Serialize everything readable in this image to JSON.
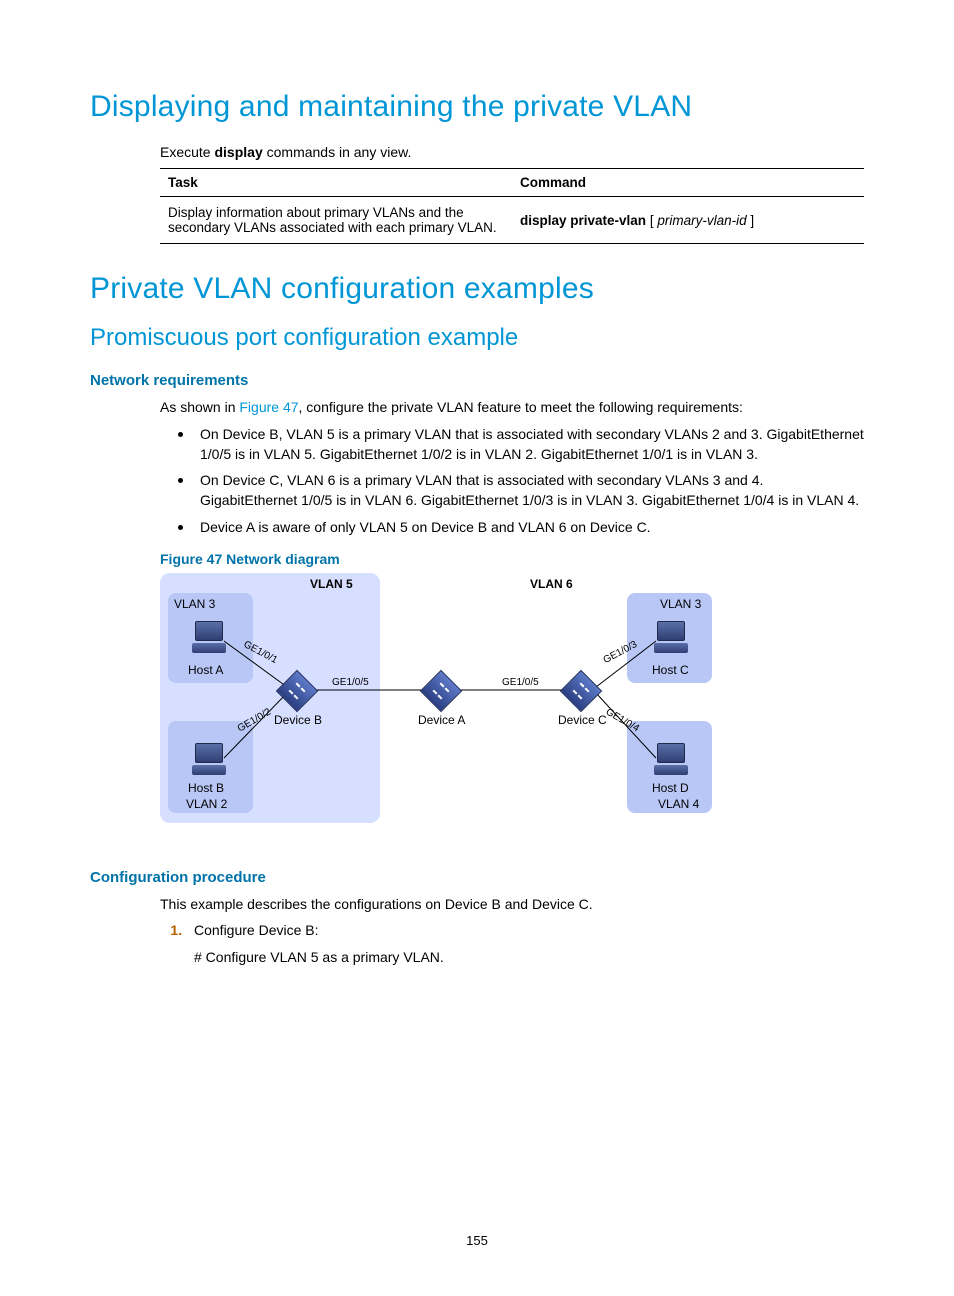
{
  "heading1": "Displaying and maintaining the private VLAN",
  "intro_prefix": "Execute ",
  "intro_bold": "display",
  "intro_suffix": " commands in any view.",
  "table": {
    "th_task": "Task",
    "th_command": "Command",
    "row0_task": "Display information about primary VLANs and the secondary VLANs associated with each primary VLAN.",
    "row0_cmd_bold": "display private-vlan",
    "row0_cmd_rest1": " [ ",
    "row0_cmd_italic": "primary-vlan-id",
    "row0_cmd_rest2": " ]"
  },
  "heading2": "Private VLAN configuration examples",
  "heading3": "Promiscuous port configuration example",
  "netreq_h": "Network requirements",
  "netreq_p_prefix": "As shown in ",
  "netreq_p_link": "Figure 47",
  "netreq_p_suffix": ", configure the private VLAN feature to meet the following requirements:",
  "bullets": [
    "On Device B, VLAN 5 is a primary VLAN that is associated with secondary VLANs 2 and 3. GigabitEthernet 1/0/5 is in VLAN 5. GigabitEthernet 1/0/2 is in VLAN 2. GigabitEthernet 1/0/1 is in VLAN 3.",
    "On Device C, VLAN 6 is a primary VLAN that is associated with secondary VLANs 3 and 4. GigabitEthernet 1/0/5 is in VLAN 6. GigabitEthernet 1/0/3 is in VLAN 3. GigabitEthernet 1/0/4 is in VLAN 4.",
    "Device A is aware of only VLAN 5 on Device B and VLAN 6 on Device C."
  ],
  "figcap": "Figure 47 Network diagram",
  "diagram": {
    "vlan5": "VLAN 5",
    "vlan6": "VLAN 6",
    "vlan3a": "VLAN 3",
    "vlan2": "VLAN 2",
    "vlan3b": "VLAN 3",
    "vlan4": "VLAN 4",
    "hostA": "Host A",
    "hostB": "Host B",
    "hostC": "Host C",
    "hostD": "Host D",
    "devA": "Device A",
    "devB": "Device B",
    "devC": "Device C",
    "ge101": "GE1/0/1",
    "ge102": "GE1/0/2",
    "ge103": "GE1/0/3",
    "ge104": "GE1/0/4",
    "ge105a": "GE1/0/5",
    "ge105b": "GE1/0/5"
  },
  "confproc_h": "Configuration procedure",
  "confproc_p": "This example describes the configurations on Device B and Device C.",
  "step1_title": "Configure Device B:",
  "step1_sub": "# Configure VLAN 5 as a primary VLAN.",
  "pagenum": "155"
}
